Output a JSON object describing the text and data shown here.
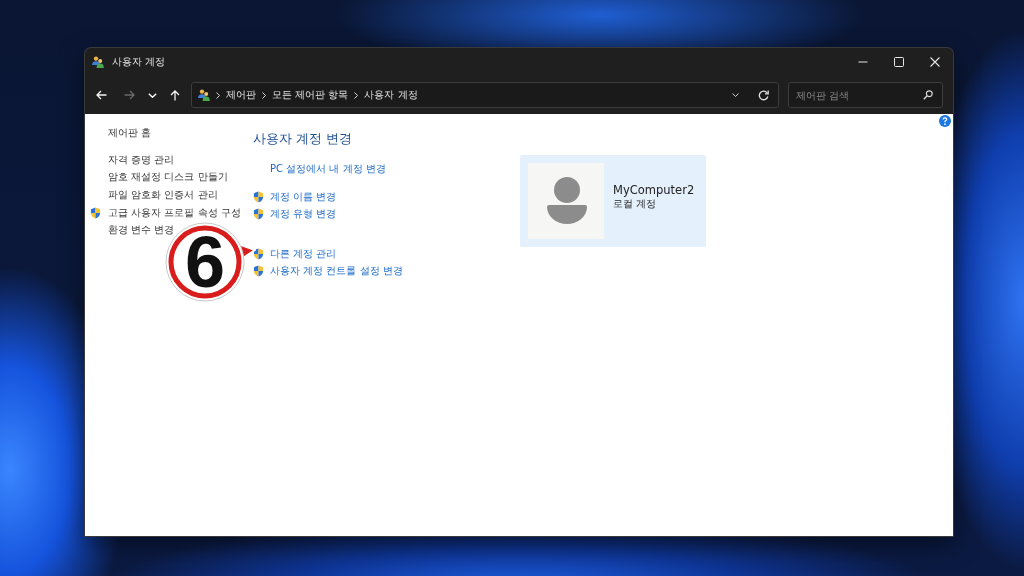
{
  "window": {
    "title": "사용자 계정"
  },
  "nav_buttons": [
    {
      "kind": "back",
      "disabled": false
    },
    {
      "kind": "forward",
      "disabled": true
    },
    {
      "kind": "recent",
      "disabled": false
    },
    {
      "kind": "up",
      "disabled": false
    }
  ],
  "address_bar": {
    "path": [
      "제어판",
      "모든 제어판 항목",
      "사용자 계정"
    ]
  },
  "search": {
    "placeholder": "제어판 검색"
  },
  "sidebar": {
    "home": "제어판 홈",
    "items": [
      {
        "label": "자격 증명 관리",
        "shield": false
      },
      {
        "label": "암호 재설정 디스크 만들기",
        "shield": false
      },
      {
        "label": "파일 암호화 인증서 관리",
        "shield": false
      },
      {
        "label": "고급 사용자 프로필 속성 구성",
        "shield": true
      },
      {
        "label": "환경 변수 변경",
        "shield": false
      }
    ]
  },
  "main": {
    "heading": "사용자 계정 변경",
    "link_groups": [
      [
        {
          "label": "PC 설정에서 내 계정 변경",
          "shield": false
        }
      ],
      [
        {
          "label": "계정 이름 변경",
          "shield": true
        },
        {
          "label": "계정 유형 변경",
          "shield": true
        }
      ],
      [
        {
          "label": "다른 계정 관리",
          "shield": true
        },
        {
          "label": "사용자 계정 컨트롤 설정 변경",
          "shield": true
        }
      ]
    ]
  },
  "account": {
    "name": "MyComputer2",
    "type": "로컬 계정"
  },
  "callout": {
    "text": "6"
  }
}
